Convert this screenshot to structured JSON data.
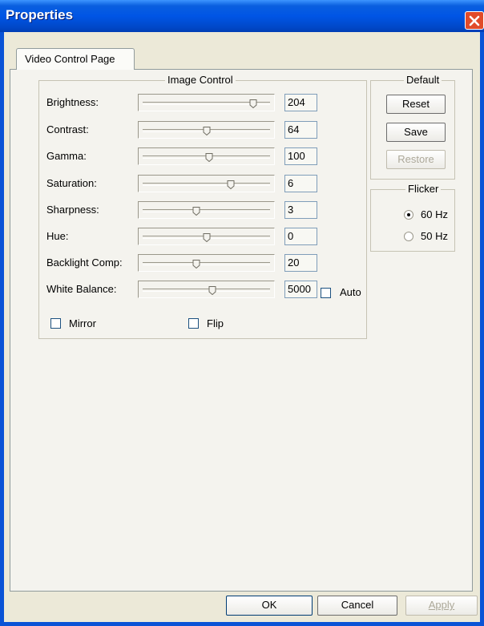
{
  "window": {
    "title": "Properties"
  },
  "tabs": [
    {
      "label": "Video Control Page",
      "selected": true
    }
  ],
  "image_control": {
    "legend": "Image Control",
    "rows": [
      {
        "label": "Brightness:",
        "value": "204",
        "slider_level": 0.88
      },
      {
        "label": "Contrast:",
        "value": "64",
        "slider_level": 0.5
      },
      {
        "label": "Gamma:",
        "value": "100",
        "slider_level": 0.52
      },
      {
        "label": "Saturation:",
        "value": "6",
        "slider_level": 0.7
      },
      {
        "label": "Sharpness:",
        "value": "3",
        "slider_level": 0.42
      },
      {
        "label": "Hue:",
        "value": "0",
        "slider_level": 0.5
      },
      {
        "label": "Backlight Comp:",
        "value": "20",
        "slider_level": 0.42
      },
      {
        "label": "White Balance:",
        "value": "5000",
        "slider_level": 0.55
      }
    ],
    "auto": {
      "label": "Auto",
      "checked": false
    },
    "mirror": {
      "label": "Mirror",
      "checked": false
    },
    "flip": {
      "label": "Flip",
      "checked": false
    }
  },
  "default_group": {
    "legend": "Default",
    "reset": "Reset",
    "save": "Save",
    "restore": "Restore"
  },
  "flicker": {
    "legend": "Flicker",
    "option_60": "60 Hz",
    "option_50": "50 Hz",
    "selected": "60 Hz"
  },
  "footer": {
    "ok": "OK",
    "cancel": "Cancel",
    "apply": "Apply"
  },
  "colors": {
    "titlebar": "#0055e5",
    "close_button": "#e14b2a",
    "dialog_bg": "#ece9d8",
    "disabled_text": "#aca899"
  }
}
